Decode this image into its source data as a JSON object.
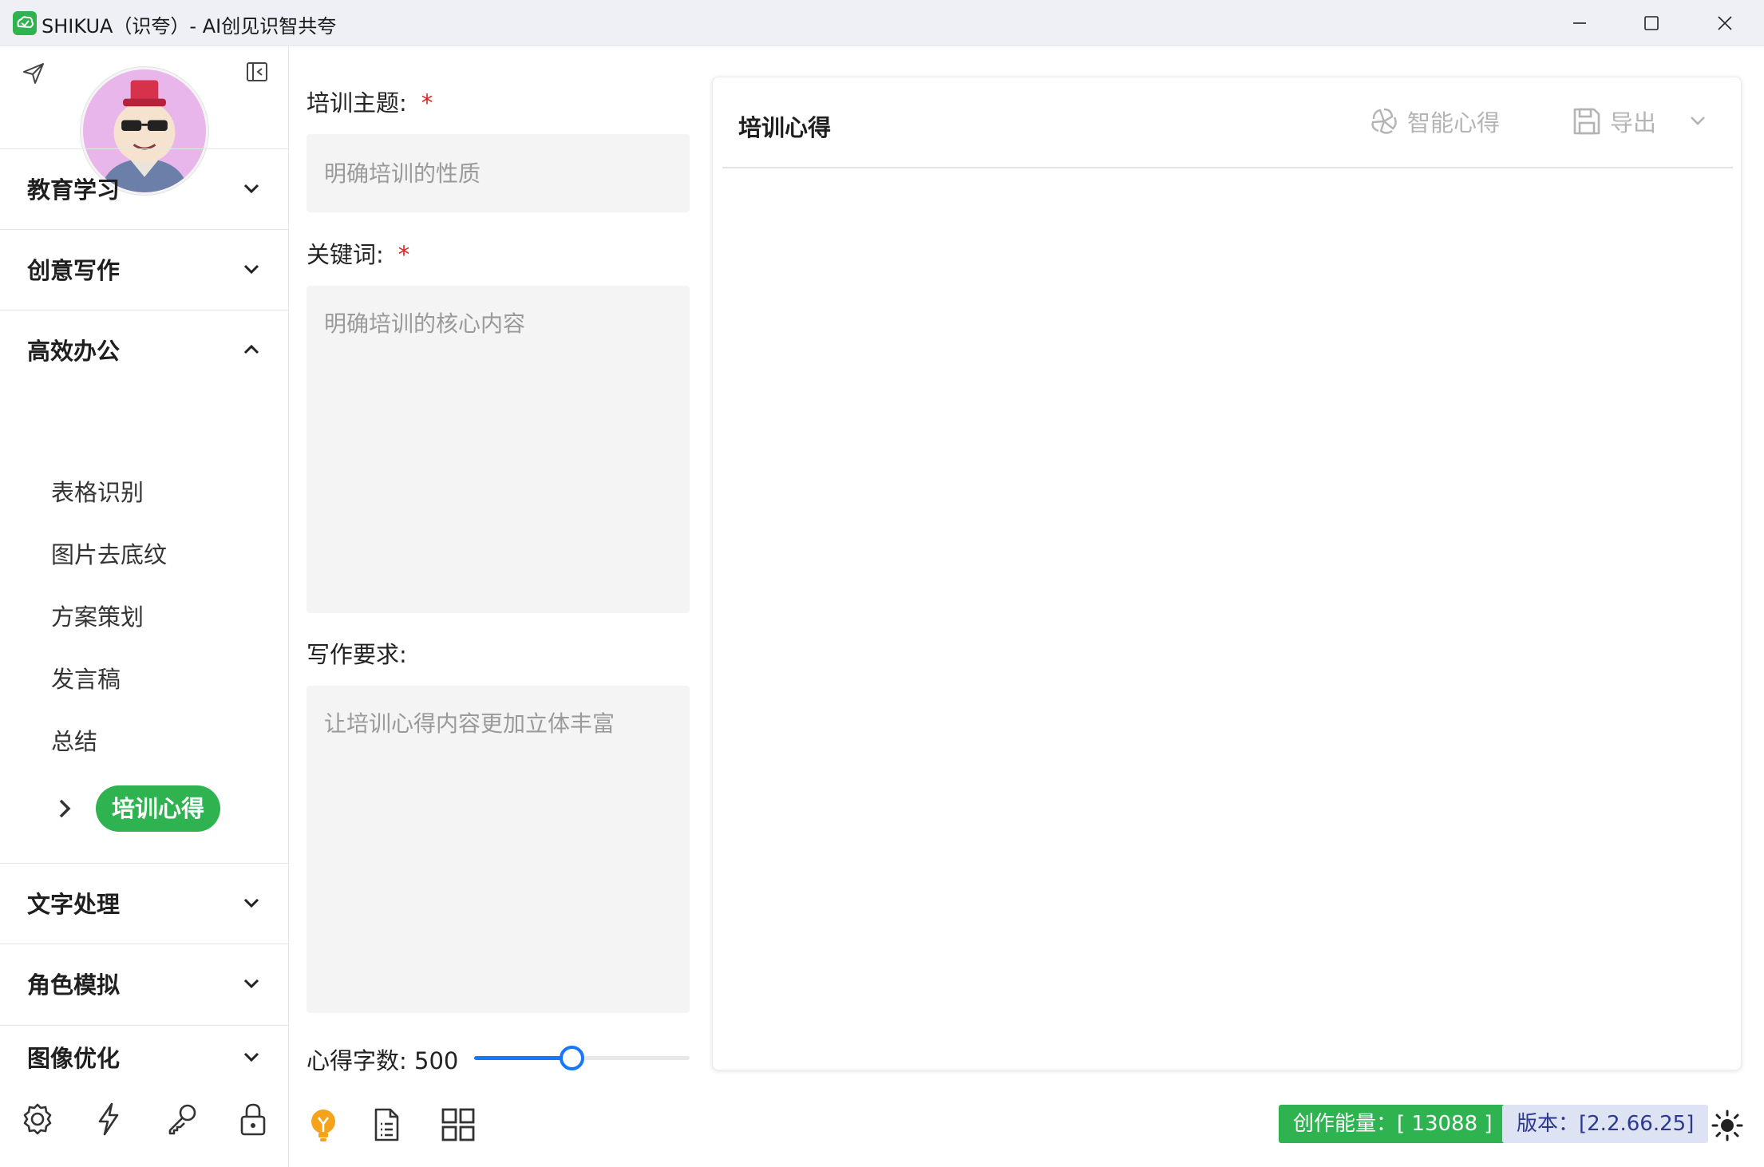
{
  "window": {
    "title": "SHIKUA（识夸）- AI创见识智共夸",
    "controls": [
      "minimize-icon",
      "maximize-icon",
      "close-icon"
    ]
  },
  "sidebar": {
    "top_icons": [
      "send-icon",
      "collapse-sidebar-icon"
    ],
    "categories": [
      {
        "label": "教育学习",
        "expanded": false
      },
      {
        "label": "创意写作",
        "expanded": false
      },
      {
        "label": "高效办公",
        "expanded": true
      },
      {
        "label": "文字处理",
        "expanded": false
      },
      {
        "label": "角色模拟",
        "expanded": false
      },
      {
        "label": "图像优化",
        "expanded": false
      }
    ],
    "office_items": [
      "表格识别",
      "图片去底纹",
      "方案策划",
      "发言稿",
      "总结"
    ],
    "active_item": "培训心得",
    "bottom_icons": [
      "settings-icon",
      "lightning-icon",
      "key-icon",
      "lock-icon"
    ]
  },
  "form": {
    "topic": {
      "label": "培训主题:",
      "required_mark": "*",
      "placeholder": "明确培训的性质",
      "value": ""
    },
    "keywords": {
      "label": "关键词:",
      "required_mark": "*",
      "placeholder": "明确培训的核心内容",
      "value": ""
    },
    "requirements": {
      "label": "写作要求:",
      "placeholder": "让培训心得内容更加立体丰富",
      "value": ""
    },
    "word_count": {
      "label": "心得字数:",
      "value": "500",
      "slider_fraction": 0.45
    },
    "toolbar_icons": [
      "lightbulb-icon",
      "document-list-icon",
      "grid-apps-icon"
    ]
  },
  "output": {
    "title": "培训心得",
    "smart_button": "智能心得",
    "export_button": "导出",
    "content": ""
  },
  "status": {
    "energy": "创作能量：[ 13088 ]",
    "version": "版本：[2.2.66.25]",
    "theme_icon": "sun-icon"
  },
  "colors": {
    "accent_green": "#2eb350",
    "slider_blue": "#1677ff",
    "required_red": "#e02020",
    "version_badge_bg": "#dde3f3"
  }
}
